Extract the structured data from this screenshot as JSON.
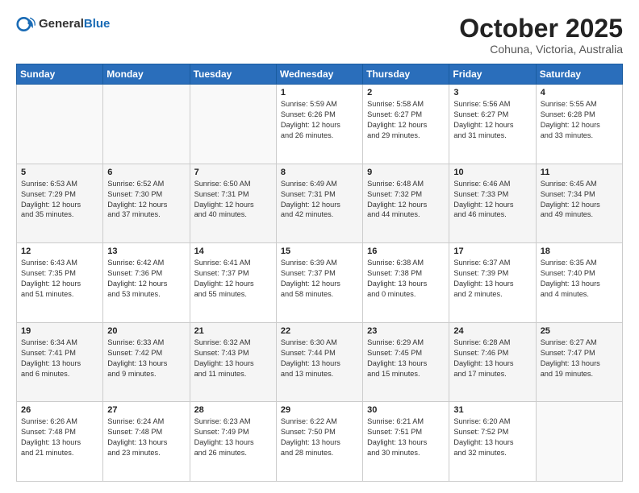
{
  "header": {
    "logo_general": "General",
    "logo_blue": "Blue",
    "month": "October 2025",
    "location": "Cohuna, Victoria, Australia"
  },
  "days_of_week": [
    "Sunday",
    "Monday",
    "Tuesday",
    "Wednesday",
    "Thursday",
    "Friday",
    "Saturday"
  ],
  "weeks": [
    [
      {
        "day": "",
        "text": ""
      },
      {
        "day": "",
        "text": ""
      },
      {
        "day": "",
        "text": ""
      },
      {
        "day": "1",
        "text": "Sunrise: 5:59 AM\nSunset: 6:26 PM\nDaylight: 12 hours\nand 26 minutes."
      },
      {
        "day": "2",
        "text": "Sunrise: 5:58 AM\nSunset: 6:27 PM\nDaylight: 12 hours\nand 29 minutes."
      },
      {
        "day": "3",
        "text": "Sunrise: 5:56 AM\nSunset: 6:27 PM\nDaylight: 12 hours\nand 31 minutes."
      },
      {
        "day": "4",
        "text": "Sunrise: 5:55 AM\nSunset: 6:28 PM\nDaylight: 12 hours\nand 33 minutes."
      }
    ],
    [
      {
        "day": "5",
        "text": "Sunrise: 6:53 AM\nSunset: 7:29 PM\nDaylight: 12 hours\nand 35 minutes."
      },
      {
        "day": "6",
        "text": "Sunrise: 6:52 AM\nSunset: 7:30 PM\nDaylight: 12 hours\nand 37 minutes."
      },
      {
        "day": "7",
        "text": "Sunrise: 6:50 AM\nSunset: 7:31 PM\nDaylight: 12 hours\nand 40 minutes."
      },
      {
        "day": "8",
        "text": "Sunrise: 6:49 AM\nSunset: 7:31 PM\nDaylight: 12 hours\nand 42 minutes."
      },
      {
        "day": "9",
        "text": "Sunrise: 6:48 AM\nSunset: 7:32 PM\nDaylight: 12 hours\nand 44 minutes."
      },
      {
        "day": "10",
        "text": "Sunrise: 6:46 AM\nSunset: 7:33 PM\nDaylight: 12 hours\nand 46 minutes."
      },
      {
        "day": "11",
        "text": "Sunrise: 6:45 AM\nSunset: 7:34 PM\nDaylight: 12 hours\nand 49 minutes."
      }
    ],
    [
      {
        "day": "12",
        "text": "Sunrise: 6:43 AM\nSunset: 7:35 PM\nDaylight: 12 hours\nand 51 minutes."
      },
      {
        "day": "13",
        "text": "Sunrise: 6:42 AM\nSunset: 7:36 PM\nDaylight: 12 hours\nand 53 minutes."
      },
      {
        "day": "14",
        "text": "Sunrise: 6:41 AM\nSunset: 7:37 PM\nDaylight: 12 hours\nand 55 minutes."
      },
      {
        "day": "15",
        "text": "Sunrise: 6:39 AM\nSunset: 7:37 PM\nDaylight: 12 hours\nand 58 minutes."
      },
      {
        "day": "16",
        "text": "Sunrise: 6:38 AM\nSunset: 7:38 PM\nDaylight: 13 hours\nand 0 minutes."
      },
      {
        "day": "17",
        "text": "Sunrise: 6:37 AM\nSunset: 7:39 PM\nDaylight: 13 hours\nand 2 minutes."
      },
      {
        "day": "18",
        "text": "Sunrise: 6:35 AM\nSunset: 7:40 PM\nDaylight: 13 hours\nand 4 minutes."
      }
    ],
    [
      {
        "day": "19",
        "text": "Sunrise: 6:34 AM\nSunset: 7:41 PM\nDaylight: 13 hours\nand 6 minutes."
      },
      {
        "day": "20",
        "text": "Sunrise: 6:33 AM\nSunset: 7:42 PM\nDaylight: 13 hours\nand 9 minutes."
      },
      {
        "day": "21",
        "text": "Sunrise: 6:32 AM\nSunset: 7:43 PM\nDaylight: 13 hours\nand 11 minutes."
      },
      {
        "day": "22",
        "text": "Sunrise: 6:30 AM\nSunset: 7:44 PM\nDaylight: 13 hours\nand 13 minutes."
      },
      {
        "day": "23",
        "text": "Sunrise: 6:29 AM\nSunset: 7:45 PM\nDaylight: 13 hours\nand 15 minutes."
      },
      {
        "day": "24",
        "text": "Sunrise: 6:28 AM\nSunset: 7:46 PM\nDaylight: 13 hours\nand 17 minutes."
      },
      {
        "day": "25",
        "text": "Sunrise: 6:27 AM\nSunset: 7:47 PM\nDaylight: 13 hours\nand 19 minutes."
      }
    ],
    [
      {
        "day": "26",
        "text": "Sunrise: 6:26 AM\nSunset: 7:48 PM\nDaylight: 13 hours\nand 21 minutes."
      },
      {
        "day": "27",
        "text": "Sunrise: 6:24 AM\nSunset: 7:48 PM\nDaylight: 13 hours\nand 23 minutes."
      },
      {
        "day": "28",
        "text": "Sunrise: 6:23 AM\nSunset: 7:49 PM\nDaylight: 13 hours\nand 26 minutes."
      },
      {
        "day": "29",
        "text": "Sunrise: 6:22 AM\nSunset: 7:50 PM\nDaylight: 13 hours\nand 28 minutes."
      },
      {
        "day": "30",
        "text": "Sunrise: 6:21 AM\nSunset: 7:51 PM\nDaylight: 13 hours\nand 30 minutes."
      },
      {
        "day": "31",
        "text": "Sunrise: 6:20 AM\nSunset: 7:52 PM\nDaylight: 13 hours\nand 32 minutes."
      },
      {
        "day": "",
        "text": ""
      }
    ]
  ]
}
